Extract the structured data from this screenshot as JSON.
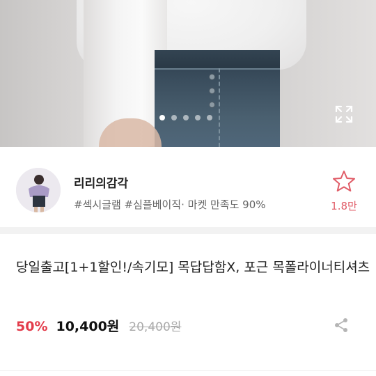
{
  "gallery": {
    "dot_count": 5,
    "active_dot": 0
  },
  "shop": {
    "name": "리리의감각",
    "tags": "#섹시글램 #심플베이직· 마켓 만족도 90%",
    "like_count": "1.8만"
  },
  "product": {
    "title": "당일출고[1+1할인!/속기모] 목답답함X, 포근 목폴라이너티셔츠",
    "discount": "50%",
    "price": "10,400원",
    "original_price": "20,400원"
  },
  "colors": {
    "accent": "#e05c67",
    "discount": "#e33c4b",
    "divider": "#f2f2f2"
  },
  "icons": {
    "expand": "expand-icon",
    "favorite": "star-outline-icon",
    "share": "share-icon"
  }
}
